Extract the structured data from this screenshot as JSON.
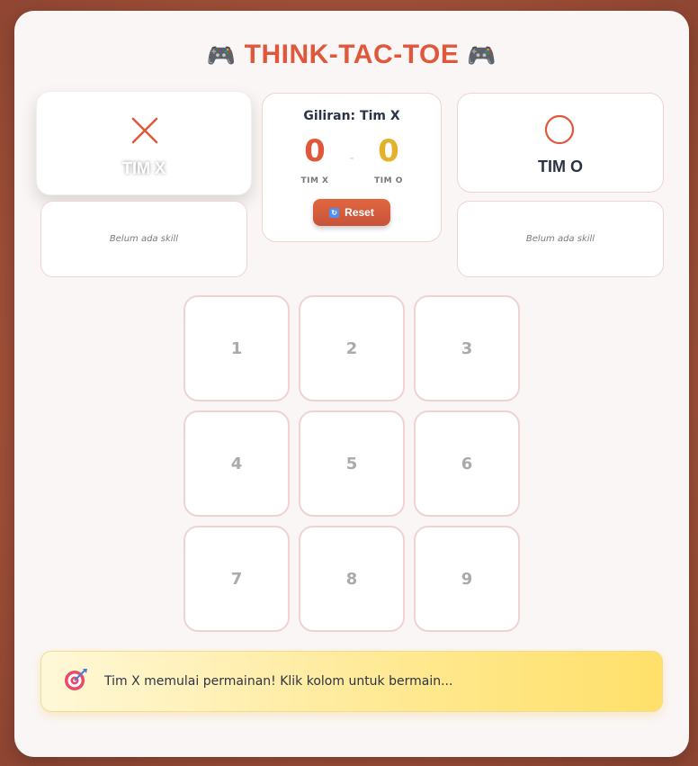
{
  "title": "THINK-TAC-TOE",
  "title_emoji": "🎮",
  "team_x": {
    "name": "TIM X",
    "mark": "x-mark-icon",
    "skill": "Belum ada skill",
    "active": true
  },
  "team_o": {
    "name": "TIM O",
    "mark": "o-mark-icon",
    "skill": "Belum ada skill",
    "active": false
  },
  "scoreboard": {
    "turn_label": "Giliran: Tim X",
    "score_x": "0",
    "score_o": "0",
    "separator": "-",
    "label_x": "TIM X",
    "label_o": "TIM O",
    "reset_label": "Reset",
    "reset_icon": "refresh-icon"
  },
  "board": {
    "cells": [
      "1",
      "2",
      "3",
      "4",
      "5",
      "6",
      "7",
      "8",
      "9"
    ]
  },
  "status": {
    "icon": "target-icon",
    "message": "Tim X memulai permainan! Klik kolom untuk bermain..."
  },
  "colors": {
    "x": "#e0583b",
    "o_score": "#e4b12b",
    "accent": "#e0583b"
  }
}
